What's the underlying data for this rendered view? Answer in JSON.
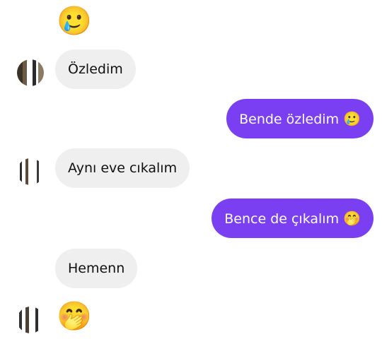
{
  "conversation": {
    "colors": {
      "incoming_bubble": "#efefef",
      "outgoing_bubble": "#7b3ff2",
      "incoming_text": "#111111",
      "outgoing_text": "#ffffff"
    },
    "top_emoji": "🥲",
    "messages": [
      {
        "side": "incoming",
        "text": "Özledim"
      },
      {
        "side": "outgoing",
        "text": "Bende özledim",
        "emoji": "🥲"
      },
      {
        "side": "incoming",
        "text": "Aynı eve cıkalım"
      },
      {
        "side": "outgoing",
        "text": "Bence de çıkalım",
        "emoji": "🤭"
      },
      {
        "side": "incoming",
        "text": "Hemenn"
      }
    ],
    "bottom_emoji": "🤭"
  }
}
